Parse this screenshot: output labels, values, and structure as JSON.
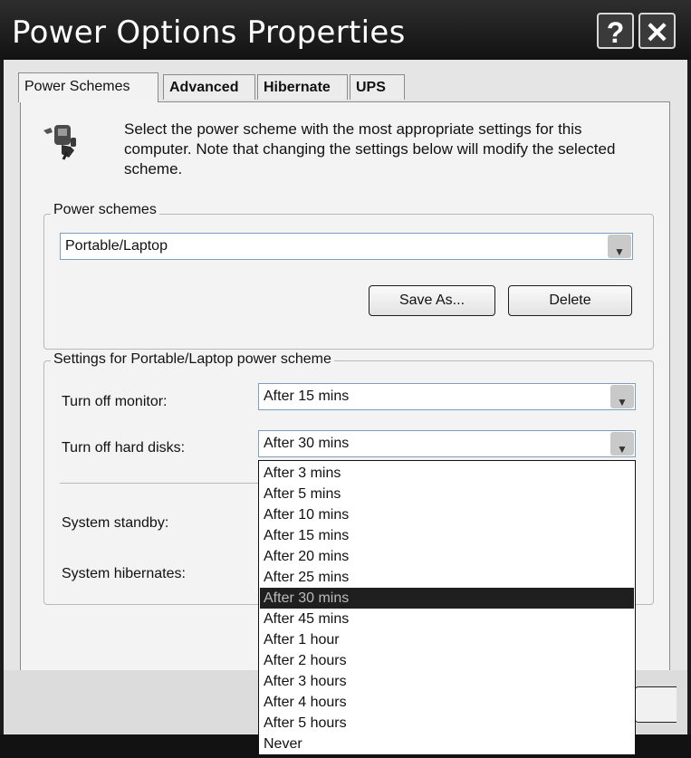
{
  "window": {
    "title": "Power Options Properties",
    "help_label": "?",
    "close_label": "✕"
  },
  "tabs": [
    {
      "label": "Power Schemes",
      "active": true
    },
    {
      "label": "Advanced"
    },
    {
      "label": "Hibernate"
    },
    {
      "label": "UPS"
    }
  ],
  "intro": {
    "icon": "power-plug-icon",
    "text": "Select the power scheme with the most appropriate settings for this computer. Note that changing the settings below will modify the selected scheme."
  },
  "schemes": {
    "legend": "Power schemes",
    "selected": "Portable/Laptop",
    "save_as_label": "Save As...",
    "delete_label": "Delete"
  },
  "settings": {
    "legend": "Settings for Portable/Laptop power scheme",
    "monitor_label": "Turn off monitor:",
    "monitor_value": "After 15 mins",
    "disks_label": "Turn off hard disks:",
    "disks_value": "After 30 mins",
    "standby_label": "System standby:",
    "hibernate_label": "System hibernates:"
  },
  "dropdown": {
    "options": [
      "After 3 mins",
      "After 5 mins",
      "After 10 mins",
      "After 15 mins",
      "After 20 mins",
      "After 25 mins",
      "After 30 mins",
      "After 45 mins",
      "After 1 hour",
      "After 2 hours",
      "After 3 hours",
      "After 4 hours",
      "After 5 hours",
      "Never"
    ],
    "selected_index": 6
  },
  "colors": {
    "titlebar": "#1b1b1b",
    "selection": "#1f1f1f",
    "panel": "#f3f3f3"
  }
}
